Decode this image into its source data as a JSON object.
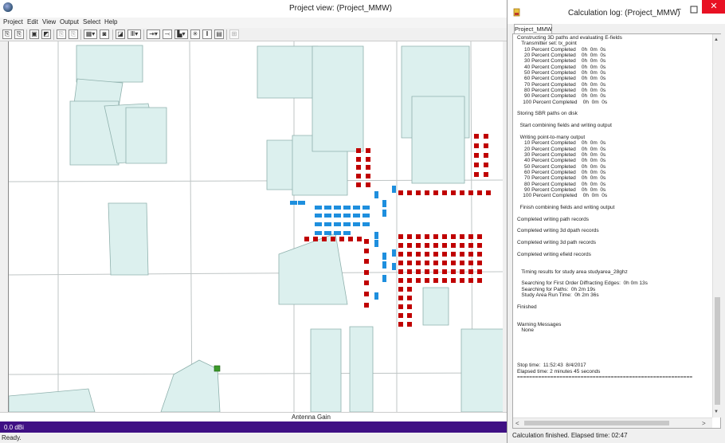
{
  "project_view": {
    "title": "Project view: (Project_MMW)",
    "menu": [
      "Project",
      "Edit",
      "View",
      "Output",
      "Select",
      "Help"
    ],
    "legend_title": "Antenna Gain",
    "gain_value": "0.0 dBi",
    "status": "Ready."
  },
  "calc_log": {
    "title": "Calculation log: (Project_MMW)",
    "tab": "Project_MMW",
    "lines": [
      "Constructing 3D paths and evaluating E-fields",
      "   Transmitter set: tx_point",
      "     10 Percent Completed    0h  0m  0s",
      "     20 Percent Completed    0h  0m  0s",
      "     30 Percent Completed    0h  0m  0s",
      "     40 Percent Completed    0h  0m  0s",
      "     50 Percent Completed    0h  0m  0s",
      "     60 Percent Completed    0h  0m  0s",
      "     70 Percent Completed    0h  0m  0s",
      "     80 Percent Completed    0h  0m  0s",
      "     90 Percent Completed    0h  0m  0s",
      "    100 Percent Completed    0h  0m  0s",
      "",
      "Storing SBR paths on disk",
      "",
      "  Start combining fields and writing output",
      "",
      "  Writing point-to-many output",
      "     10 Percent Completed    0h  0m  0s",
      "     20 Percent Completed    0h  0m  0s",
      "     30 Percent Completed    0h  0m  0s",
      "     40 Percent Completed    0h  0m  0s",
      "     50 Percent Completed    0h  0m  0s",
      "     60 Percent Completed    0h  0m  0s",
      "     70 Percent Completed    0h  0m  0s",
      "     80 Percent Completed    0h  0m  0s",
      "     90 Percent Completed    0h  0m  0s",
      "    100 Percent Completed    0h  0m  0s",
      "",
      "  Finish combining fields and writing output",
      "",
      "Completed writing path records",
      "",
      "Completed writing 3d dpath records",
      "",
      "Completed writing 3d path records",
      "",
      "Completed writing efield records",
      "",
      "",
      "   Timing results for study area studyarea_28ghz",
      "",
      "   Searching for First Order Diffracting Edges:  0h 0m 13s",
      "   Searching for Paths:  0h 2m 19s",
      "   Study Area Run Time:  0h 2m 36s",
      "",
      "Finished",
      "",
      "",
      "Warning Messages",
      "   None",
      "",
      "",
      "",
      "",
      "",
      "Stop time:  11:52:43  8/4/2017",
      "Elapsed time: 2 minutes 45 seconds",
      "=========================================================="
    ],
    "status": "Calculation finished.  Elapsed time: 02:47"
  },
  "colors": {
    "building": "#dcf0ee",
    "building_stroke": "#8fb1ad",
    "road": "#bfc5c5",
    "rx_red": "#c00000",
    "rx_blue": "#1e8fde",
    "tx_green": "#3c9a2a",
    "gain_bar": "#3f1084"
  }
}
